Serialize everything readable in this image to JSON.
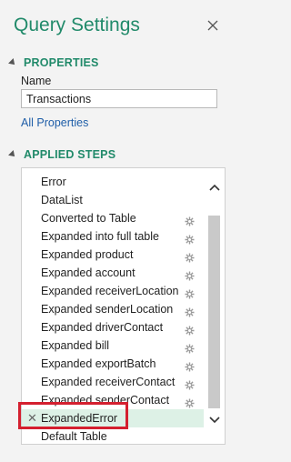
{
  "panel": {
    "title": "Query Settings"
  },
  "properties": {
    "header": "PROPERTIES",
    "name_label": "Name",
    "name_value": "Transactions",
    "all_properties_link": "All Properties"
  },
  "applied_steps": {
    "header": "APPLIED STEPS",
    "steps": [
      {
        "label": "Error",
        "has_gear": false
      },
      {
        "label": "DataList",
        "has_gear": false
      },
      {
        "label": "Converted to Table",
        "has_gear": true
      },
      {
        "label": "Expanded into full table",
        "has_gear": true
      },
      {
        "label": "Expanded product",
        "has_gear": true
      },
      {
        "label": "Expanded account",
        "has_gear": true
      },
      {
        "label": "Expanded receiverLocation",
        "has_gear": true
      },
      {
        "label": "Expanded senderLocation",
        "has_gear": true
      },
      {
        "label": "Expanded driverContact",
        "has_gear": true
      },
      {
        "label": "Expanded bill",
        "has_gear": true
      },
      {
        "label": "Expanded exportBatch",
        "has_gear": true
      },
      {
        "label": "Expanded receiverContact",
        "has_gear": true
      },
      {
        "label": "Expanded senderContact",
        "has_gear": true
      },
      {
        "label": "ExpandedError",
        "has_gear": false,
        "selected": true
      },
      {
        "label": "Default Table",
        "has_gear": false
      }
    ]
  },
  "colors": {
    "accent": "#218a6a",
    "link": "#1f5ea8",
    "selected_row": "#ddf1e6",
    "callout": "#d4202f"
  },
  "icons": {
    "close": "close-icon",
    "step_settings": "gear-icon",
    "delete_step": "x-icon"
  }
}
